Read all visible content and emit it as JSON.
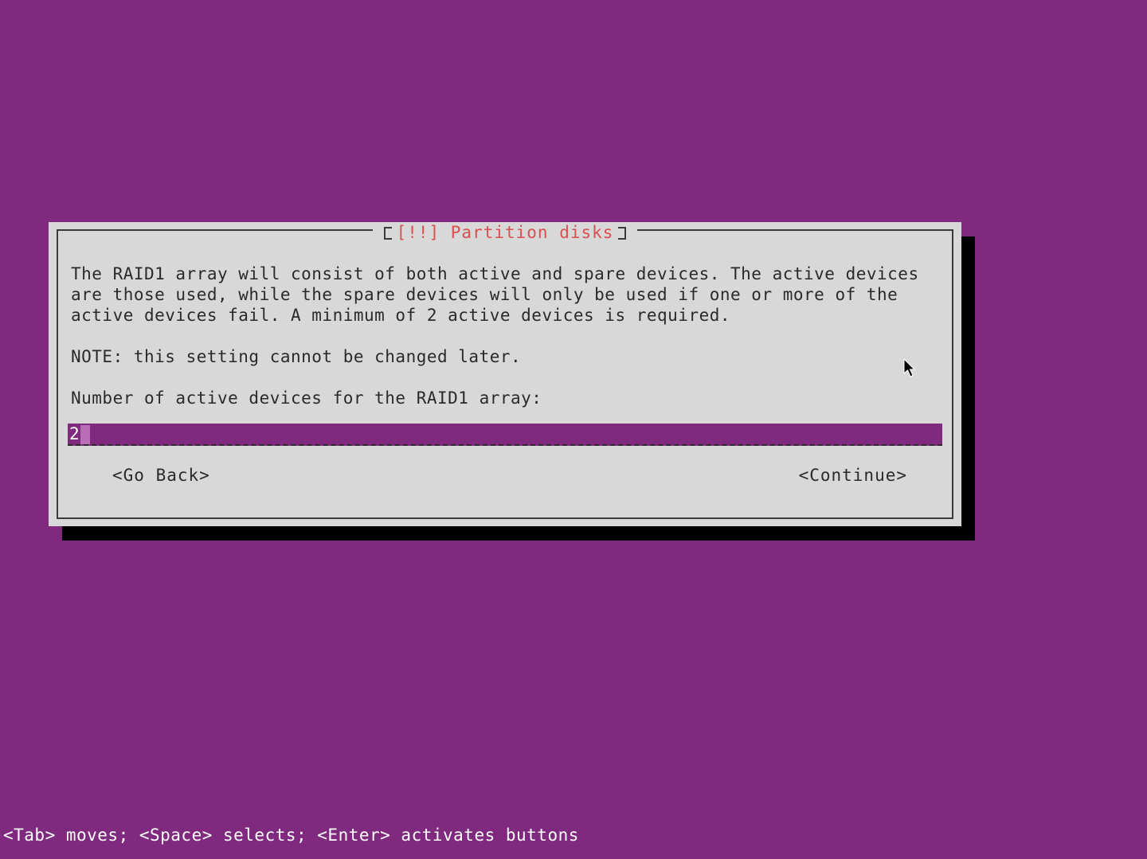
{
  "dialog": {
    "title": "[!!] Partition disks",
    "description": "The RAID1 array will consist of both active and spare devices. The active devices are those used, while the spare devices will only be used if one or more of the active devices fail. A minimum of 2 active devices is required.",
    "note": "NOTE: this setting cannot be changed later.",
    "prompt": "Number of active devices for the RAID1 array:",
    "input_value": "2",
    "go_back_label": "<Go Back>",
    "continue_label": "<Continue>"
  },
  "footer": {
    "hint": "<Tab> moves; <Space> selects; <Enter> activates buttons"
  }
}
